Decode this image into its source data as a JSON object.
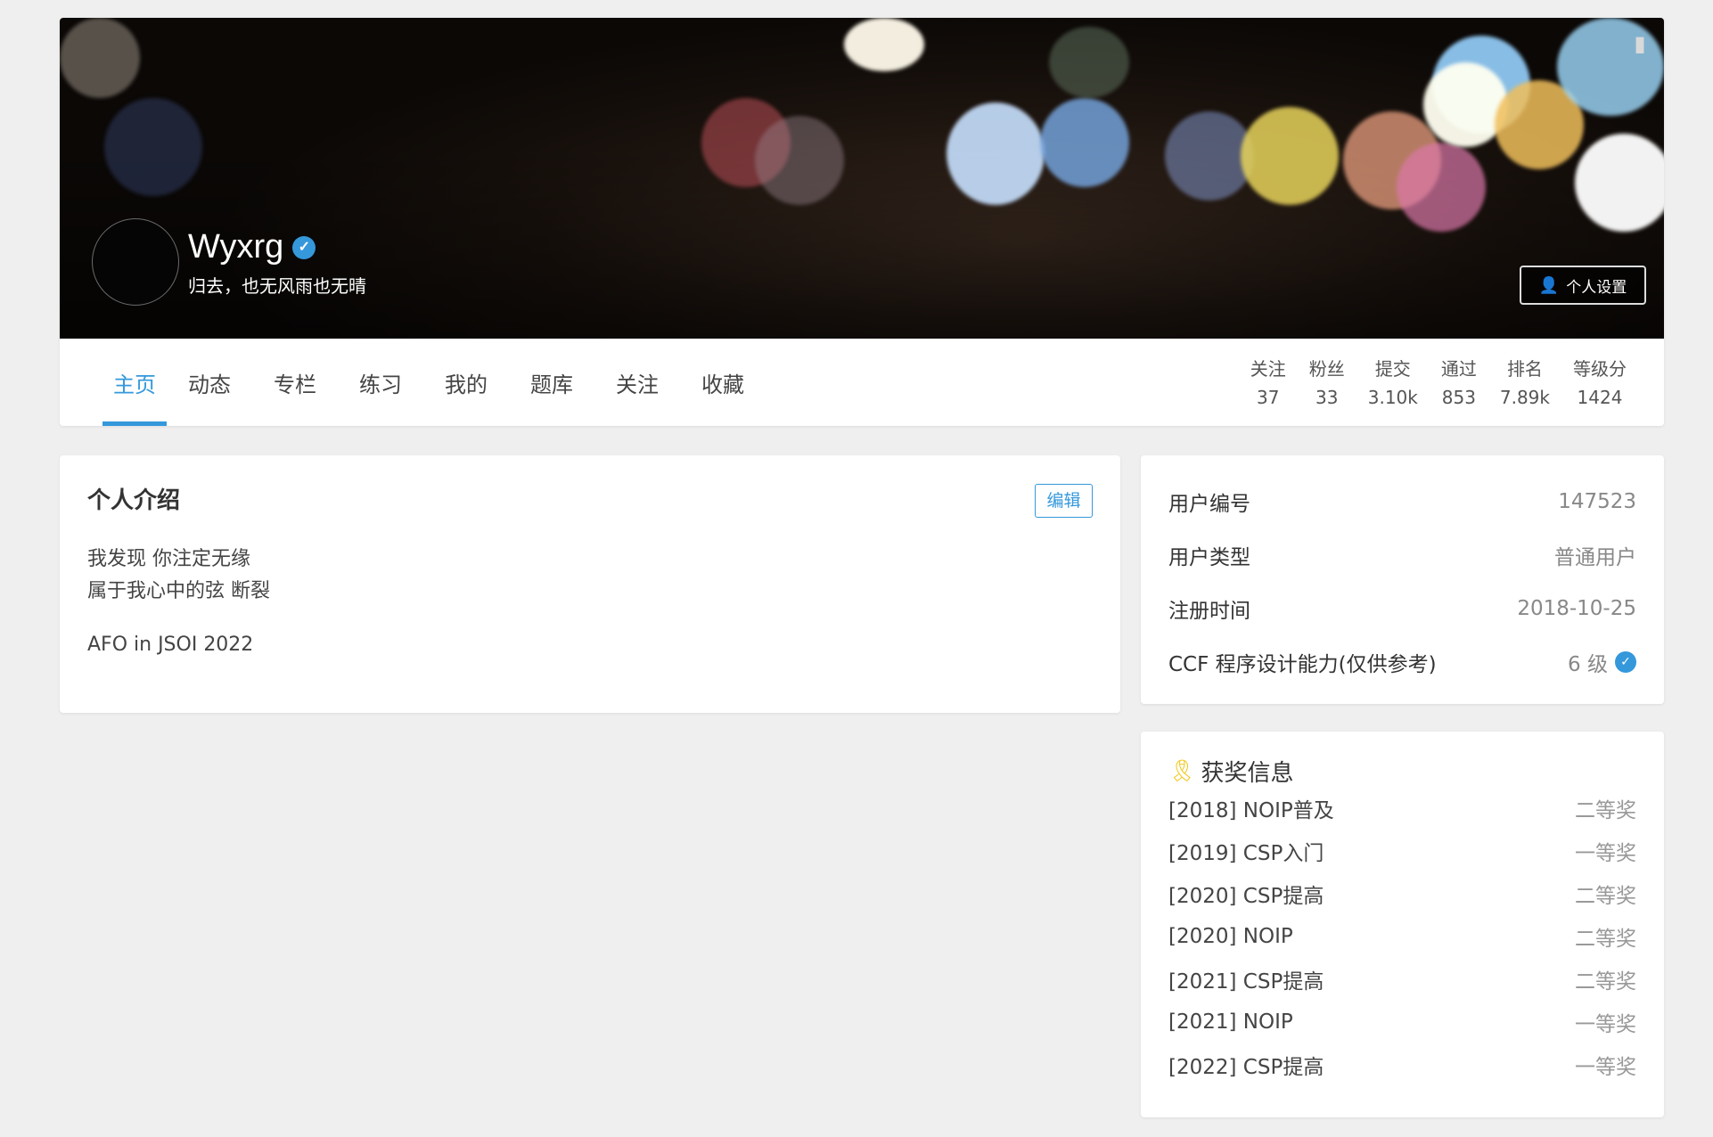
{
  "profile": {
    "username": "Wyxrg",
    "slogan": "归去，也无风雨也无晴",
    "settings_label": "个人设置"
  },
  "tabs": [
    "主页",
    "动态",
    "专栏",
    "练习",
    "我的",
    "题库",
    "关注",
    "收藏"
  ],
  "active_tab": "主页",
  "stats": [
    {
      "label": "关注",
      "value": "37"
    },
    {
      "label": "粉丝",
      "value": "33"
    },
    {
      "label": "提交",
      "value": "3.10k"
    },
    {
      "label": "通过",
      "value": "853"
    },
    {
      "label": "排名",
      "value": "7.89k"
    },
    {
      "label": "等级分",
      "value": "1424"
    }
  ],
  "intro": {
    "title": "个人介绍",
    "edit_label": "编辑",
    "lines": [
      "我发现 你注定无缘",
      "属于我心中的弦 断裂"
    ],
    "extra": "AFO in JSOI 2022"
  },
  "info": [
    {
      "label": "用户编号",
      "value": "147523"
    },
    {
      "label": "用户类型",
      "value": "普通用户"
    },
    {
      "label": "注册时间",
      "value": "2018-10-25"
    },
    {
      "label": "CCF 程序设计能力(仅供参考)",
      "value": "6 级"
    }
  ],
  "awards": {
    "title": "获奖信息",
    "items": [
      {
        "name": "[2018] NOIP普及",
        "prize": "二等奖"
      },
      {
        "name": "[2019] CSP入门",
        "prize": "一等奖"
      },
      {
        "name": "[2020] CSP提高",
        "prize": "二等奖"
      },
      {
        "name": "[2020] NOIP",
        "prize": "二等奖"
      },
      {
        "name": "[2021] CSP提高",
        "prize": "二等奖"
      },
      {
        "name": "[2021] NOIP",
        "prize": "一等奖"
      },
      {
        "name": "[2022] CSP提高",
        "prize": "一等奖"
      }
    ]
  },
  "icons": {
    "verified": "verified-check-icon",
    "settings": "user-gear-icon",
    "medal": "award-medal-icon",
    "corner": "brush-icon"
  },
  "colors": {
    "accent": "#3498db",
    "medal": "#f1c40f"
  }
}
